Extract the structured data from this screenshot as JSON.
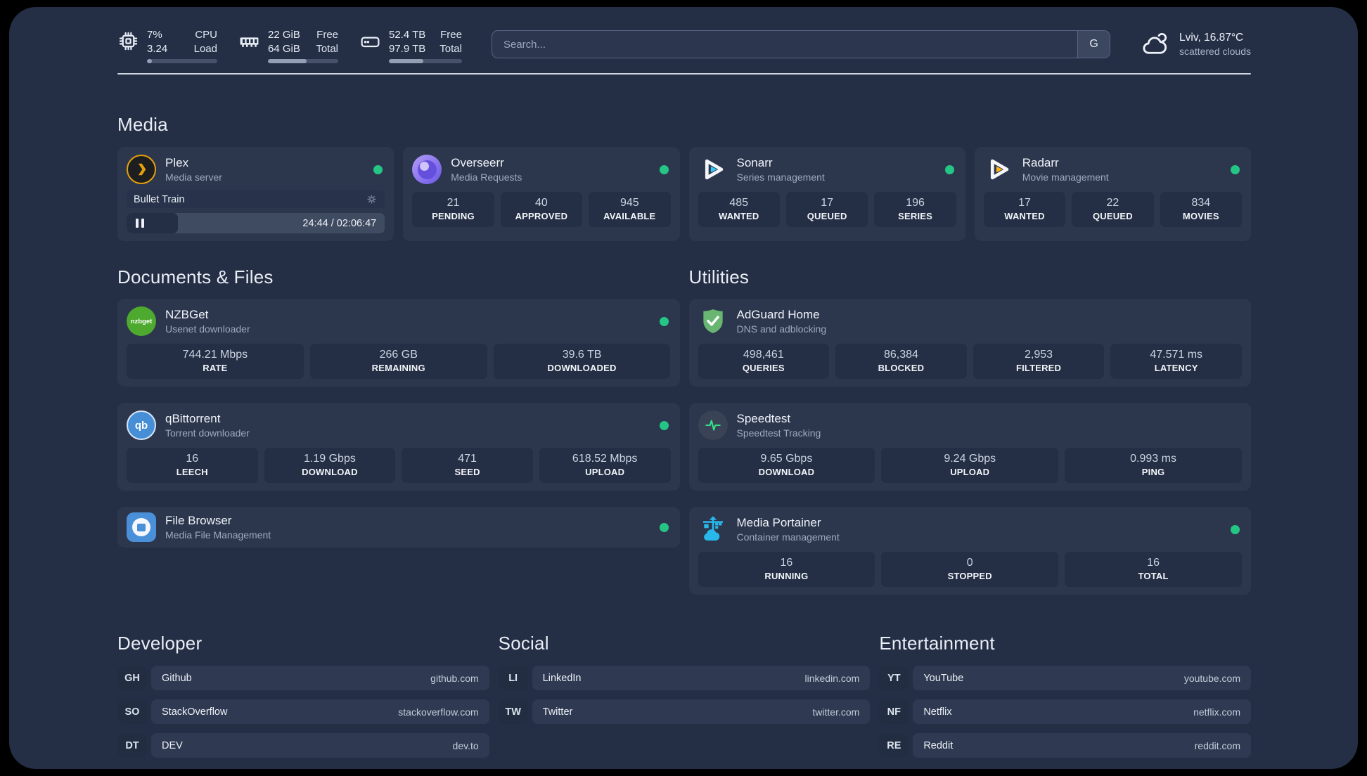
{
  "colors": {
    "status_online": "#25c685",
    "plex_accent": "#e5a00d",
    "sonarr_accent": "#35c5f4",
    "radarr_accent": "#fdb514",
    "nzbget_accent": "#4daa2e",
    "qbittorrent_accent": "#468fd6",
    "adguard_accent": "#68b671",
    "speedtest_accent": "#35e08a",
    "portainer_accent": "#29b8eb"
  },
  "topbar": {
    "resources": [
      {
        "icon": "cpu-icon",
        "values": [
          "7%",
          "3.24"
        ],
        "labels": [
          "CPU",
          "Load"
        ],
        "progress": 7
      },
      {
        "icon": "memory-icon",
        "values": [
          "22 GiB",
          "64 GiB"
        ],
        "labels": [
          "Free",
          "Total"
        ],
        "progress": 55
      },
      {
        "icon": "disk-icon",
        "values": [
          "52.4 TB",
          "97.9 TB"
        ],
        "labels": [
          "Free",
          "Total"
        ],
        "progress": 47
      }
    ],
    "search": {
      "placeholder": "Search...",
      "provider_button": "G"
    },
    "weather": {
      "location": "Lviv, 16.87°C",
      "condition": "scattered clouds"
    }
  },
  "sections": {
    "media": {
      "title": "Media",
      "cards": {
        "plex": {
          "title": "Plex",
          "subtitle": "Media server",
          "now_playing": {
            "title": "Bullet Train",
            "time": "24:44 / 02:06:47",
            "progress": 20
          }
        },
        "overseerr": {
          "title": "Overseerr",
          "subtitle": "Media Requests",
          "stats": [
            {
              "value": "21",
              "label": "PENDING"
            },
            {
              "value": "40",
              "label": "APPROVED"
            },
            {
              "value": "945",
              "label": "AVAILABLE"
            }
          ]
        },
        "sonarr": {
          "title": "Sonarr",
          "subtitle": "Series management",
          "stats": [
            {
              "value": "485",
              "label": "WANTED"
            },
            {
              "value": "17",
              "label": "QUEUED"
            },
            {
              "value": "196",
              "label": "SERIES"
            }
          ]
        },
        "radarr": {
          "title": "Radarr",
          "subtitle": "Movie management",
          "stats": [
            {
              "value": "17",
              "label": "WANTED"
            },
            {
              "value": "22",
              "label": "QUEUED"
            },
            {
              "value": "834",
              "label": "MOVIES"
            }
          ]
        }
      }
    },
    "documents": {
      "title": "Documents & Files",
      "cards": {
        "nzbget": {
          "title": "NZBGet",
          "subtitle": "Usenet downloader",
          "icon_text": "nzbget",
          "stats": [
            {
              "value": "744.21 Mbps",
              "label": "RATE"
            },
            {
              "value": "266 GB",
              "label": "REMAINING"
            },
            {
              "value": "39.6 TB",
              "label": "DOWNLOADED"
            }
          ]
        },
        "qbittorrent": {
          "title": "qBittorrent",
          "subtitle": "Torrent downloader",
          "icon_text": "qb",
          "stats": [
            {
              "value": "16",
              "label": "LEECH"
            },
            {
              "value": "1.19 Gbps",
              "label": "DOWNLOAD"
            },
            {
              "value": "471",
              "label": "SEED"
            },
            {
              "value": "618.52 Mbps",
              "label": "UPLOAD"
            }
          ]
        },
        "filebrowser": {
          "title": "File Browser",
          "subtitle": "Media File Management"
        }
      }
    },
    "utilities": {
      "title": "Utilities",
      "cards": {
        "adguard": {
          "title": "AdGuard Home",
          "subtitle": "DNS and adblocking",
          "stats": [
            {
              "value": "498,461",
              "label": "QUERIES"
            },
            {
              "value": "86,384",
              "label": "BLOCKED"
            },
            {
              "value": "2,953",
              "label": "FILTERED"
            },
            {
              "value": "47.571 ms",
              "label": "LATENCY"
            }
          ]
        },
        "speedtest": {
          "title": "Speedtest",
          "subtitle": "Speedtest Tracking",
          "stats": [
            {
              "value": "9.65 Gbps",
              "label": "DOWNLOAD"
            },
            {
              "value": "9.24 Gbps",
              "label": "UPLOAD"
            },
            {
              "value": "0.993 ms",
              "label": "PING"
            }
          ]
        },
        "portainer": {
          "title": "Media Portainer",
          "subtitle": "Container management",
          "stats": [
            {
              "value": "16",
              "label": "RUNNING"
            },
            {
              "value": "0",
              "label": "STOPPED"
            },
            {
              "value": "16",
              "label": "TOTAL"
            }
          ]
        }
      }
    },
    "bookmarks": {
      "developer": {
        "title": "Developer",
        "items": [
          {
            "abbr": "GH",
            "name": "Github",
            "url": "github.com"
          },
          {
            "abbr": "SO",
            "name": "StackOverflow",
            "url": "stackoverflow.com"
          },
          {
            "abbr": "DT",
            "name": "DEV",
            "url": "dev.to"
          }
        ]
      },
      "social": {
        "title": "Social",
        "items": [
          {
            "abbr": "LI",
            "name": "LinkedIn",
            "url": "linkedin.com"
          },
          {
            "abbr": "TW",
            "name": "Twitter",
            "url": "twitter.com"
          }
        ]
      },
      "entertainment": {
        "title": "Entertainment",
        "items": [
          {
            "abbr": "YT",
            "name": "YouTube",
            "url": "youtube.com"
          },
          {
            "abbr": "NF",
            "name": "Netflix",
            "url": "netflix.com"
          },
          {
            "abbr": "RE",
            "name": "Reddit",
            "url": "reddit.com"
          }
        ]
      }
    }
  }
}
